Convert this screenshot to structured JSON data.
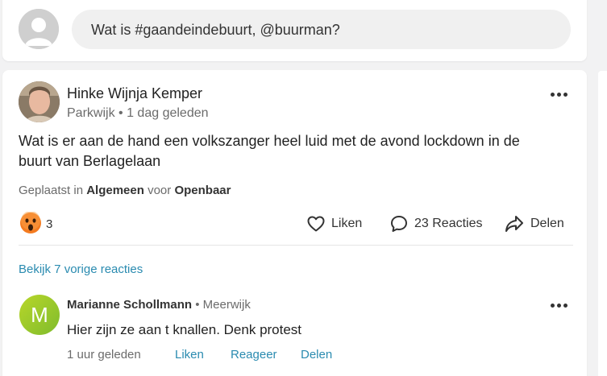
{
  "compose": {
    "placeholder": "Wat is #gaandeindebuurt, @buurman?"
  },
  "post": {
    "author": "Hinke Wijnja Kemper",
    "neighbourhood": "Parkwijk",
    "separator": "•",
    "time": "1 dag geleden",
    "body": "Wat is er aan de hand een volkszanger heel luid met de avond lockdown in de buurt van Berlagelaan",
    "placement_prefix": "Geplaatst in",
    "category": "Algemeen",
    "placement_mid": "voor",
    "audience": "Openbaar",
    "reaction_count": "3",
    "like_label": "Liken",
    "comments_label": "23 Reacties",
    "share_label": "Delen",
    "previous_comments": "Bekijk 7 vorige reacties"
  },
  "comment": {
    "initial": "M",
    "author": "Marianne Schollmann",
    "separator": " • ",
    "location": "Meerwijk",
    "text": "Hier zijn ze aan t knallen. Denk protest",
    "time": "1 uur geleden",
    "like_label": "Liken",
    "reply_label": "Reageer",
    "share_label": "Delen"
  },
  "colors": {
    "link": "#2a8bb0",
    "avatar_green": "#9cc92b",
    "emoji_orange": "#f47b20"
  },
  "icons": {
    "reaction": "surprised-face-icon",
    "like": "heart-outline-icon",
    "comments": "speech-bubble-icon",
    "share": "share-arrow-icon",
    "more": "more-horizontal-icon"
  }
}
